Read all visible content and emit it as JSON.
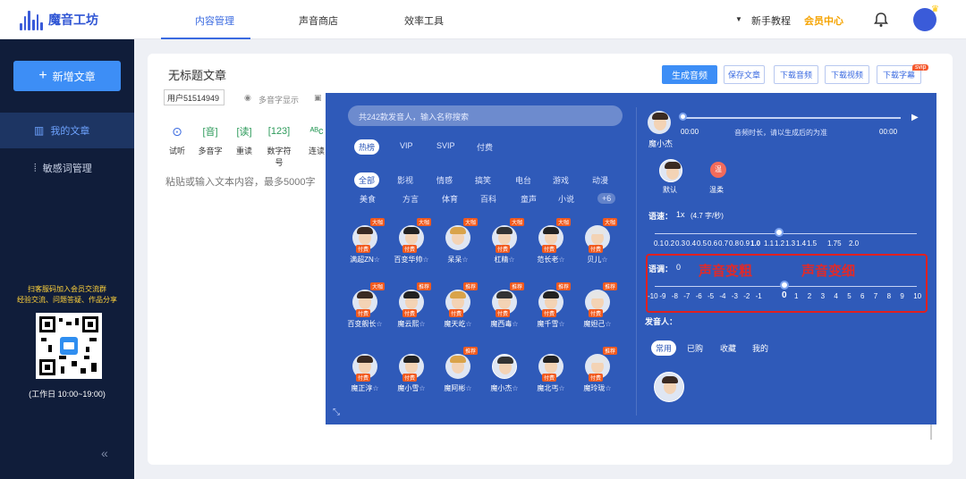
{
  "app": {
    "name": "魔音工坊"
  },
  "nav": {
    "tabs": [
      "内容管理",
      "声音商店",
      "效率工具"
    ],
    "tutorial": "新手教程",
    "vip": "会员中心"
  },
  "sidebar": {
    "new_button": "新增文章",
    "items": [
      "我的文章",
      "敏感词管理"
    ],
    "promo": "扫客服码加入会员交流群\n经验交流、问题答疑、作品分享",
    "hours": "(工作日 10:00~19:00)",
    "collapse": "«"
  },
  "editor": {
    "title": "无标题文章",
    "user": "用户51514949",
    "multi": "多音字显示",
    "placeholder": "粘贴或输入文本内容，最多5000字",
    "buttons": {
      "generate": "生成音频",
      "save": "保存文章",
      "dl_audio": "下载音频",
      "dl_video": "下载视频",
      "dl_sub": "下载字幕",
      "svip": "svip"
    },
    "tools": [
      "试听",
      "多音字",
      "重读",
      "数字符号",
      "连读"
    ]
  },
  "voice_panel": {
    "search_placeholder": "共242款发音人，输入名称搜索",
    "top_tabs": [
      "热榜",
      "VIP",
      "SVIP",
      "付费"
    ],
    "cats_row1": [
      "全部",
      "影视",
      "情感",
      "搞笑",
      "电台",
      "游戏",
      "动漫"
    ],
    "cats_row2": [
      "美食",
      "方言",
      "体育",
      "百科",
      "童声",
      "小说",
      "+6"
    ],
    "voices": [
      {
        "name": "满超ZN",
        "tag": "大咖",
        "paid": "付费"
      },
      {
        "name": "百变华帅",
        "tag": "大咖",
        "paid": "付费"
      },
      {
        "name": "呆呆",
        "tag": "大咖",
        "paid": ""
      },
      {
        "name": "杠精",
        "tag": "大咖",
        "paid": "付费"
      },
      {
        "name": "范长老",
        "tag": "大咖",
        "paid": "付费"
      },
      {
        "name": "贝儿",
        "tag": "大咖",
        "paid": "付费"
      },
      {
        "name": "百变舰长",
        "tag": "大咖",
        "paid": "付费"
      },
      {
        "name": "魔云熙",
        "tag": "推荐",
        "paid": "付费"
      },
      {
        "name": "魔天屹",
        "tag": "推荐",
        "paid": "付费"
      },
      {
        "name": "魔西毒",
        "tag": "推荐",
        "paid": "付费"
      },
      {
        "name": "魔千雪",
        "tag": "推荐",
        "paid": "付费"
      },
      {
        "name": "魔妲己",
        "tag": "推荐",
        "paid": "付费"
      },
      {
        "name": "魔正淳",
        "tag": "",
        "paid": "付费"
      },
      {
        "name": "魔小雪",
        "tag": "",
        "paid": "付费"
      },
      {
        "name": "魔阿彬",
        "tag": "推荐",
        "paid": ""
      },
      {
        "name": "魔小杰",
        "tag": "",
        "paid": ""
      },
      {
        "name": "魔北丐",
        "tag": "",
        "paid": "付费"
      },
      {
        "name": "魔玲珑",
        "tag": "推荐",
        "paid": "付费"
      }
    ],
    "player": {
      "name": "魔小杰",
      "start": "00:00",
      "end": "00:00",
      "hint": "音频时长，请以生成后的为准"
    },
    "styles": [
      {
        "label": "默认"
      },
      {
        "label": "温柔",
        "badge": "温"
      }
    ],
    "speed": {
      "label": "语速：",
      "value": "1x",
      "note": "(4.7 字/秒)",
      "ticks": [
        "0.1",
        "0.2",
        "0.3",
        "0.4",
        "0.5",
        "0.6",
        "0.7",
        "0.8",
        "0.9",
        "1.0",
        "1.1",
        "1.2",
        "1.3",
        "1.4",
        "1.5",
        "1.75",
        "2.0"
      ]
    },
    "pitch": {
      "label": "语调：",
      "value": "0",
      "ticks": [
        "-10",
        "-9",
        "-8",
        "-7",
        "-6",
        "-5",
        "-4",
        "-3",
        "-2",
        "-1",
        "0",
        "1",
        "2",
        "3",
        "4",
        "5",
        "6",
        "7",
        "8",
        "9",
        "10"
      ]
    },
    "annot": {
      "thick": "声音变粗",
      "thin": "声音变细"
    },
    "speaker_label": "发音人：",
    "speaker_tabs": [
      "常用",
      "已购",
      "收藏",
      "我的"
    ]
  }
}
